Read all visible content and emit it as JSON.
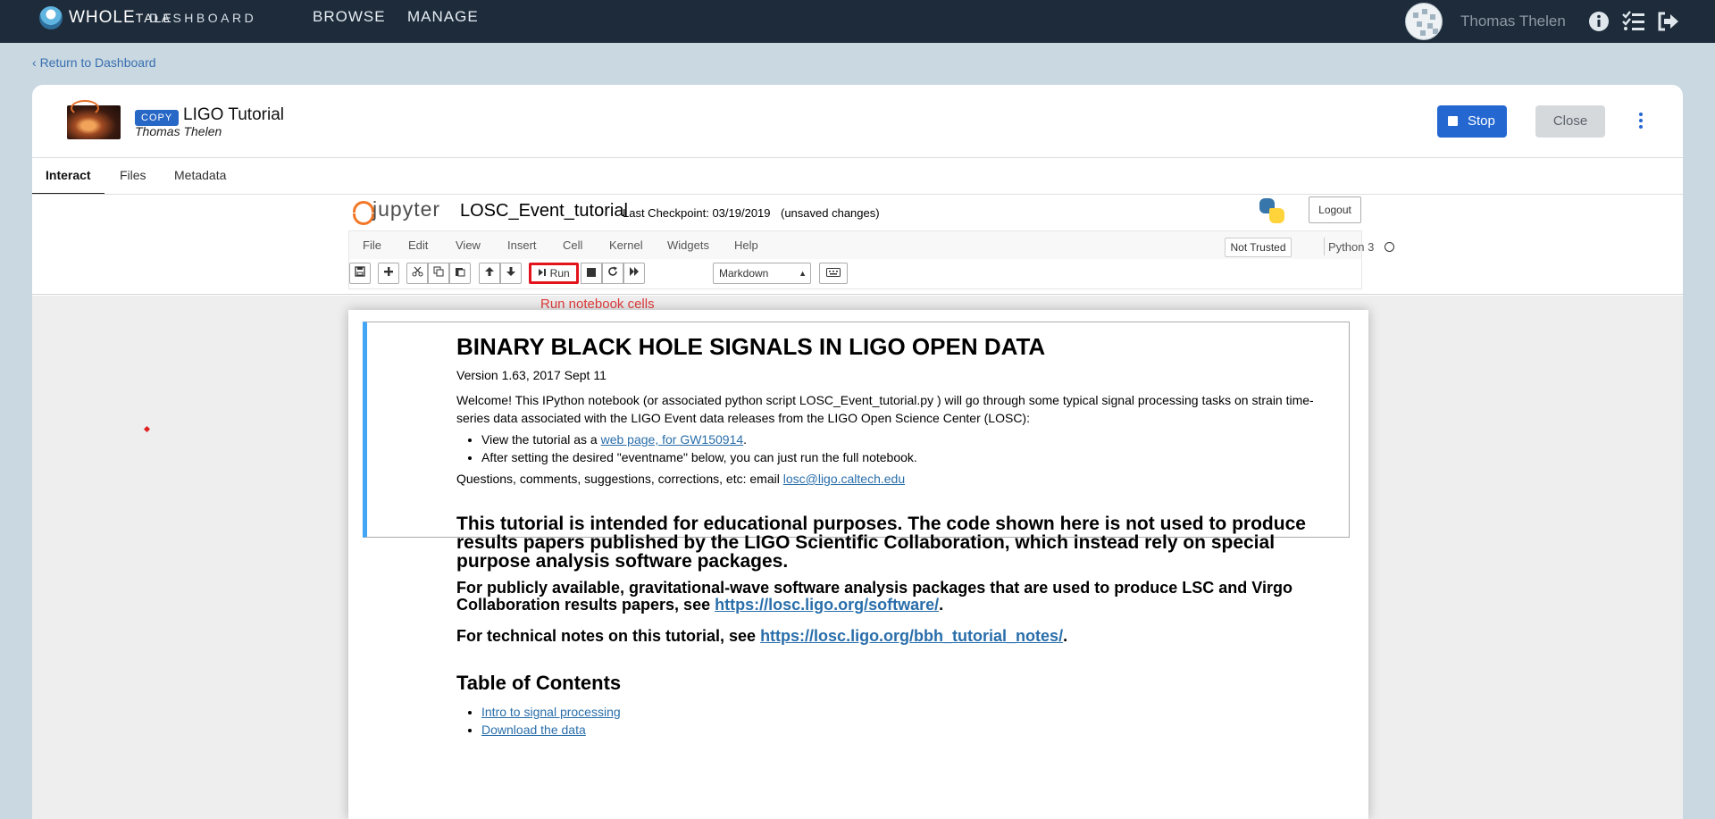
{
  "topnav": {
    "brand_whole": "WHOLE",
    "brand_tale": "TALE",
    "dashboard": "DASHBOARD",
    "browse": "BROWSE",
    "manage": "MANAGE",
    "username": "Thomas Thelen"
  },
  "return_link": "Return to Dashboard",
  "tale": {
    "badge": "COPY",
    "title": "LIGO Tutorial",
    "author": "Thomas Thelen",
    "stop_label": "Stop",
    "close_label": "Close"
  },
  "tabs": [
    "Interact",
    "Files",
    "Metadata"
  ],
  "jupyter": {
    "logo_text": "jupyter",
    "notebook_name": "LOSC_Event_tutorial",
    "checkpoint": "Last Checkpoint: 03/19/2019",
    "autosave": "(unsaved changes)",
    "logout": "Logout",
    "menu": [
      "File",
      "Edit",
      "View",
      "Insert",
      "Cell",
      "Kernel",
      "Widgets",
      "Help"
    ],
    "trusted": "Not Trusted",
    "kernel": "Python 3",
    "run_label": "Run",
    "cell_type": "Markdown",
    "run_hint": "Run notebook cells"
  },
  "notebook": {
    "title": "BINARY BLACK HOLE SIGNALS IN LIGO OPEN DATA",
    "version": "Version 1.63, 2017 Sept 11",
    "welcome": "Welcome! This IPython notebook (or associated python script LOSC_Event_tutorial.py ) will go through some typical signal processing tasks on strain time-series data associated with the LIGO Event data releases from the LIGO Open Science Center (LOSC):",
    "bullet1_prefix": "View the tutorial as a ",
    "bullet1_link": "web page, for GW150914",
    "bullet1_suffix": ".",
    "bullet2": "After setting the desired \"eventname\" below, you can just run the full notebook.",
    "questions_prefix": "Questions, comments, suggestions, corrections, etc: email ",
    "questions_email": "losc@ligo.caltech.edu",
    "intended": "This tutorial is intended for educational purposes. The code shown here is not used to produce results papers published by the LIGO Scientific Collaboration, which instead rely on special purpose analysis software packages.",
    "packages_prefix": "For publicly available, gravitational-wave software analysis packages that are used to produce LSC and Virgo Collaboration results papers, see ",
    "packages_link": "https://losc.ligo.org/software/",
    "packages_suffix": ".",
    "technical_prefix": "For technical notes on this tutorial, see ",
    "technical_link": "https://losc.ligo.org/bbh_tutorial_notes/",
    "technical_suffix": ".",
    "toc_title": "Table of Contents",
    "toc": [
      "Intro to signal processing",
      "Download the data"
    ]
  }
}
